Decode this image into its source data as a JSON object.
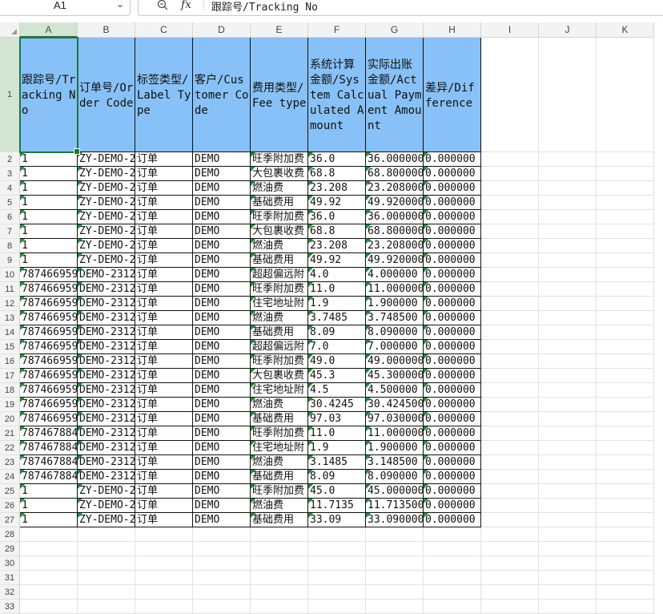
{
  "formula_bar": {
    "name_box": "A1",
    "formula": "跟踪号/Tracking No"
  },
  "columns": [
    "A",
    "B",
    "C",
    "D",
    "E",
    "F",
    "G",
    "H",
    "I",
    "J",
    "K"
  ],
  "rows": [
    "1",
    "2",
    "3",
    "4",
    "5",
    "6",
    "7",
    "8",
    "9",
    "10",
    "11",
    "12",
    "13",
    "14",
    "15",
    "16",
    "17",
    "18",
    "19",
    "20",
    "21",
    "22",
    "23",
    "24",
    "25",
    "26",
    "27",
    "28",
    "29",
    "30",
    "31",
    "32",
    "33"
  ],
  "headers": [
    "跟踪号/Tracking No",
    "订单号/Order Code",
    "标签类型/Label Type",
    "客户/Customer Code",
    "费用类型/Fee type",
    "系统计算金额/System Calculated Amount",
    "实际出账金额/Actual Payment Amount",
    "差异/Difference"
  ],
  "table": [
    [
      "1",
      "ZY-DEMO-2",
      "订单",
      "DEMO",
      "旺季附加费",
      "36.0",
      "36.000000",
      "0.000000"
    ],
    [
      "1",
      "ZY-DEMO-2",
      "订单",
      "DEMO",
      "大包裹收费",
      "68.8",
      "68.800000",
      "0.000000"
    ],
    [
      "1",
      "ZY-DEMO-2",
      "订单",
      "DEMO",
      "燃油费",
      "23.208",
      "23.208000",
      "0.000000"
    ],
    [
      "1",
      "ZY-DEMO-2",
      "订单",
      "DEMO",
      "基础费用",
      "49.92",
      "49.920000",
      "0.000000"
    ],
    [
      "1",
      "ZY-DEMO-2",
      "订单",
      "DEMO",
      "旺季附加费",
      "36.0",
      "36.000000",
      "0.000000"
    ],
    [
      "1",
      "ZY-DEMO-2",
      "订单",
      "DEMO",
      "大包裹收费",
      "68.8",
      "68.800000",
      "0.000000"
    ],
    [
      "1",
      "ZY-DEMO-2",
      "订单",
      "DEMO",
      "燃油费",
      "23.208",
      "23.208000",
      "0.000000"
    ],
    [
      "1",
      "ZY-DEMO-2",
      "订单",
      "DEMO",
      "基础费用",
      "49.92",
      "49.920000",
      "0.000000"
    ],
    [
      "787466959",
      "DEMO-2312",
      "订单",
      "DEMO",
      "超超偏远附",
      "4.0",
      "4.000000",
      "0.000000"
    ],
    [
      "787466959",
      "DEMO-2312",
      "订单",
      "DEMO",
      "旺季附加费",
      "11.0",
      "11.000000",
      "0.000000"
    ],
    [
      "787466959",
      "DEMO-2312",
      "订单",
      "DEMO",
      "住宅地址附",
      "1.9",
      "1.900000",
      "0.000000"
    ],
    [
      "787466959",
      "DEMO-2312",
      "订单",
      "DEMO",
      "燃油费",
      "3.7485",
      "3.748500",
      "0.000000"
    ],
    [
      "787466959",
      "DEMO-2312",
      "订单",
      "DEMO",
      "基础费用",
      "8.09",
      "8.090000",
      "0.000000"
    ],
    [
      "787466959",
      "DEMO-2312",
      "订单",
      "DEMO",
      "超超偏远附",
      "7.0",
      "7.000000",
      "0.000000"
    ],
    [
      "787466959",
      "DEMO-2312",
      "订单",
      "DEMO",
      "旺季附加费",
      "49.0",
      "49.000000",
      "0.000000"
    ],
    [
      "787466959",
      "DEMO-2312",
      "订单",
      "DEMO",
      "大包裹收费",
      "45.3",
      "45.300000",
      "0.000000"
    ],
    [
      "787466959",
      "DEMO-2312",
      "订单",
      "DEMO",
      "住宅地址附",
      "4.5",
      "4.500000",
      "0.000000"
    ],
    [
      "787466959",
      "DEMO-2312",
      "订单",
      "DEMO",
      "燃油费",
      "30.4245",
      "30.424500",
      "0.000000"
    ],
    [
      "787466959",
      "DEMO-2312",
      "订单",
      "DEMO",
      "基础费用",
      "97.03",
      "97.030000",
      "0.000000"
    ],
    [
      "787467884",
      "DEMO-2312",
      "订单",
      "DEMO",
      "旺季附加费",
      "11.0",
      "11.000000",
      "0.000000"
    ],
    [
      "787467884",
      "DEMO-2312",
      "订单",
      "DEMO",
      "住宅地址附",
      "1.9",
      "1.900000",
      "0.000000"
    ],
    [
      "787467884",
      "DEMO-2312",
      "订单",
      "DEMO",
      "燃油费",
      "3.1485",
      "3.148500",
      "0.000000"
    ],
    [
      "787467884",
      "DEMO-2312",
      "订单",
      "DEMO",
      "基础费用",
      "8.09",
      "8.090000",
      "0.000000"
    ],
    [
      "1",
      "ZY-DEMO-2",
      "订单",
      "DEMO",
      "旺季附加费",
      "45.0",
      "45.000000",
      "0.000000"
    ],
    [
      "1",
      "ZY-DEMO-2",
      "订单",
      "DEMO",
      "燃油费",
      "11.7135",
      "11.713500",
      "0.000000"
    ],
    [
      "1",
      "ZY-DEMO-2",
      "订单",
      "DEMO",
      "基础费用",
      "33.09",
      "33.090000",
      "0.000000"
    ]
  ],
  "icons": {
    "zoom": "zoom-icon",
    "function": "fx-icon",
    "dropdown": "chevron-down-icon",
    "select_all": "select-all-triangle-icon"
  },
  "colors": {
    "header_fill": "#87c1f7",
    "selection": "#217346",
    "green_tag": "#1f8a3b"
  }
}
